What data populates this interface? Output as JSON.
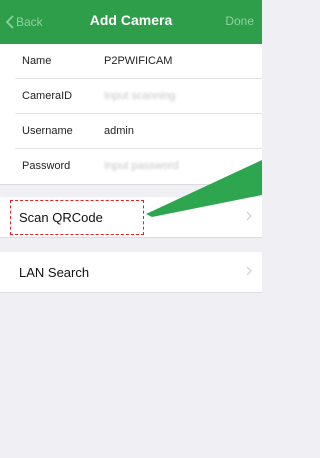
{
  "nav": {
    "back_label": "Back",
    "title": "Add Camera",
    "done_label": "Done"
  },
  "form": {
    "rows": [
      {
        "label": "Name",
        "value": "P2PWIFICAM",
        "placeholder": ""
      },
      {
        "label": "CameraID",
        "value": "",
        "placeholder": "Input scanning"
      },
      {
        "label": "Username",
        "value": "admin",
        "placeholder": ""
      },
      {
        "label": "Password",
        "value": "",
        "placeholder": "Input password"
      }
    ]
  },
  "actions": {
    "scan_label": "Scan QRCode",
    "lan_label": "LAN Search"
  },
  "colors": {
    "navbar": "#2f9e4a",
    "callout_arrow": "#2ea54f",
    "highlight_border": "#e2202a"
  }
}
